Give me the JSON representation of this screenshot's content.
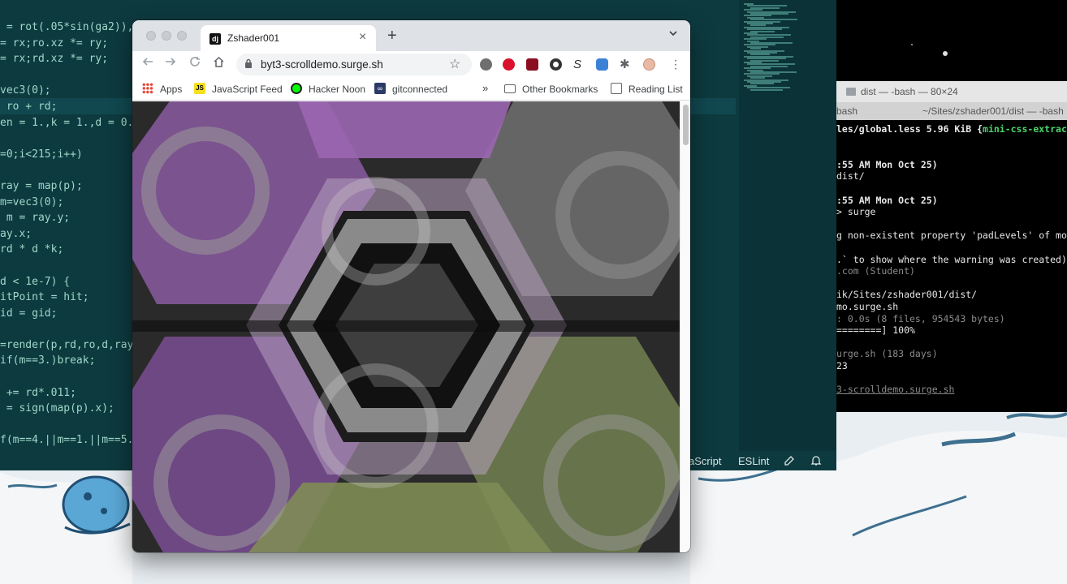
{
  "colors": {
    "editor_bg": "#0d3a3f",
    "terminal_bg": "#000000",
    "chrome_tabstrip": "#dee1e6",
    "accent_green": "#49d66a",
    "hex_purple": "#8a5aa0",
    "hex_gray": "#7c7c7c",
    "hex_olive": "#6f7d4f"
  },
  "editor": {
    "code_lines": [
      " = rot(.05*sin(ga2)),",
      "= rx;ro.xz *= ry;",
      "= rx;rd.xz *= ry;",
      "",
      "vec3(0);",
      " ro + rd;",
      "en = 1.,k = 1.,d = 0.",
      "",
      "=0;i<215;i++)",
      "",
      "ray = map(p);",
      "m=vec3(0);",
      " m = ray.y;",
      "ay.x;",
      "rd * d *k;",
      "",
      "d < 1e-7) {",
      "itPoint = hit;",
      "id = gid;",
      "",
      "=render(p,rd,ro,d,ray",
      "if(m==3.)break;",
      "",
      " += rd*.011;",
      " = sign(map(p).x);",
      "",
      "f(m==4.||m==1.||m==5."
    ],
    "status": {
      "language": "aScript",
      "eslint": "ESLint"
    }
  },
  "terminal": {
    "title": "dist — -bash — 80×24",
    "tabs": [
      "bash",
      "~/Sites/zshader001/dist — -bash"
    ],
    "lines": [
      {
        "t": "les/global.less 5.96 KiB {",
        "g": "mini-css-extract-pl",
        "cls": "b"
      },
      {
        "t": "",
        "cls": ""
      },
      {
        "t": "",
        "cls": ""
      },
      {
        "t": ":55 AM Mon Oct 25)",
        "cls": "b"
      },
      {
        "t": "dist/",
        "cls": ""
      },
      {
        "t": "",
        "cls": ""
      },
      {
        "t": ":55 AM Mon Oct 25)",
        "cls": "b"
      },
      {
        "t": "> surge",
        "cls": ""
      },
      {
        "t": "",
        "cls": ""
      },
      {
        "t": "g non-existent property 'padLevels' of module",
        "cls": ""
      },
      {
        "t": "",
        "cls": ""
      },
      {
        "t": ".` to show where the warning was created)",
        "cls": ""
      },
      {
        "t": ".com (Student)",
        "cls": "dim"
      },
      {
        "t": "",
        "cls": ""
      },
      {
        "t": "ik/Sites/zshader001/dist/",
        "cls": ""
      },
      {
        "t": "mo.surge.sh",
        "cls": ""
      },
      {
        "t": ": 0.0s (8 files, 954543 bytes)",
        "cls": "dim"
      },
      {
        "t": "========] 100%",
        "cls": ""
      },
      {
        "t": "",
        "cls": ""
      },
      {
        "t": "urge.sh (183 days)",
        "cls": "dim"
      },
      {
        "t": "23",
        "cls": ""
      },
      {
        "t": "",
        "cls": ""
      },
      {
        "t": "3-scrolldemo.surge.sh",
        "cls": "u"
      }
    ]
  },
  "browser": {
    "tab_title": "Zshader001",
    "tab_favicon": "dj",
    "new_tab": "+",
    "url": "byt3-scrolldemo.surge.sh",
    "bookmarks": {
      "apps": "Apps",
      "js_feed": "JavaScript Feed",
      "hacker_noon": "Hacker Noon",
      "gitconnected": "gitconnected",
      "more": "»",
      "other": "Other Bookmarks",
      "reading_list": "Reading List"
    }
  }
}
